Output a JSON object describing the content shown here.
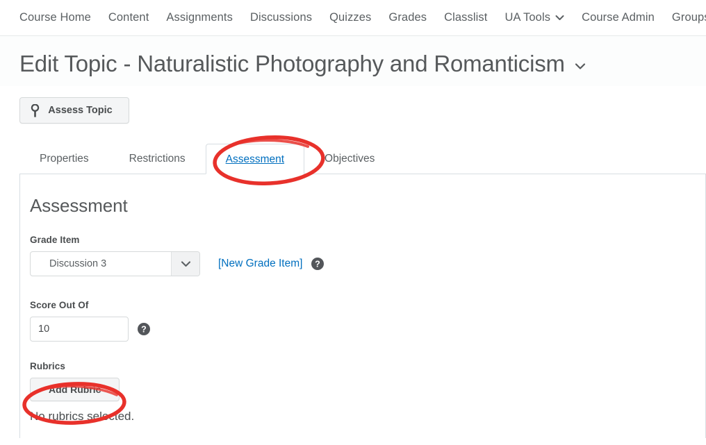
{
  "navbar": {
    "items": [
      {
        "label": "Course Home",
        "caret": false
      },
      {
        "label": "Content",
        "caret": false
      },
      {
        "label": "Assignments",
        "caret": false
      },
      {
        "label": "Discussions",
        "caret": false
      },
      {
        "label": "Quizzes",
        "caret": false
      },
      {
        "label": "Grades",
        "caret": false
      },
      {
        "label": "Classlist",
        "caret": false
      },
      {
        "label": "UA Tools",
        "caret": true
      },
      {
        "label": "Course Admin",
        "caret": false
      },
      {
        "label": "Groups",
        "caret": false
      }
    ]
  },
  "header": {
    "title": "Edit Topic - Naturalistic Photography and Romanticism",
    "caret_icon": "chevron-down-icon"
  },
  "actions": {
    "assess_topic_label": "Assess Topic",
    "assess_topic_icon": "key-icon"
  },
  "tabs": [
    {
      "label": "Properties",
      "active": false
    },
    {
      "label": "Restrictions",
      "active": false
    },
    {
      "label": "Assessment",
      "active": true
    },
    {
      "label": "Objectives",
      "active": false
    }
  ],
  "main": {
    "section_title": "Assessment",
    "grade_item": {
      "label": "Grade Item",
      "selected": "Discussion 3",
      "dropdown_icon": "chevron-down-icon",
      "new_grade_item_link": "[New Grade Item]",
      "help_icon": "question-mark-icon"
    },
    "score_out_of": {
      "label": "Score Out Of",
      "value": "10",
      "help_icon": "question-mark-icon"
    },
    "rubrics": {
      "label": "Rubrics",
      "add_rubric_label": "Add Rubric",
      "empty_text": "No rubrics selected."
    }
  },
  "annotations": [
    {
      "name": "assessment-tab-highlight",
      "target": "Assessment tab"
    },
    {
      "name": "add-rubric-highlight",
      "target": "Add Rubric button"
    }
  ],
  "colors": {
    "accent_link": "#006fbf",
    "annotation_red": "#e8312b",
    "text": "#494c4e",
    "muted_text": "#5b6063"
  }
}
